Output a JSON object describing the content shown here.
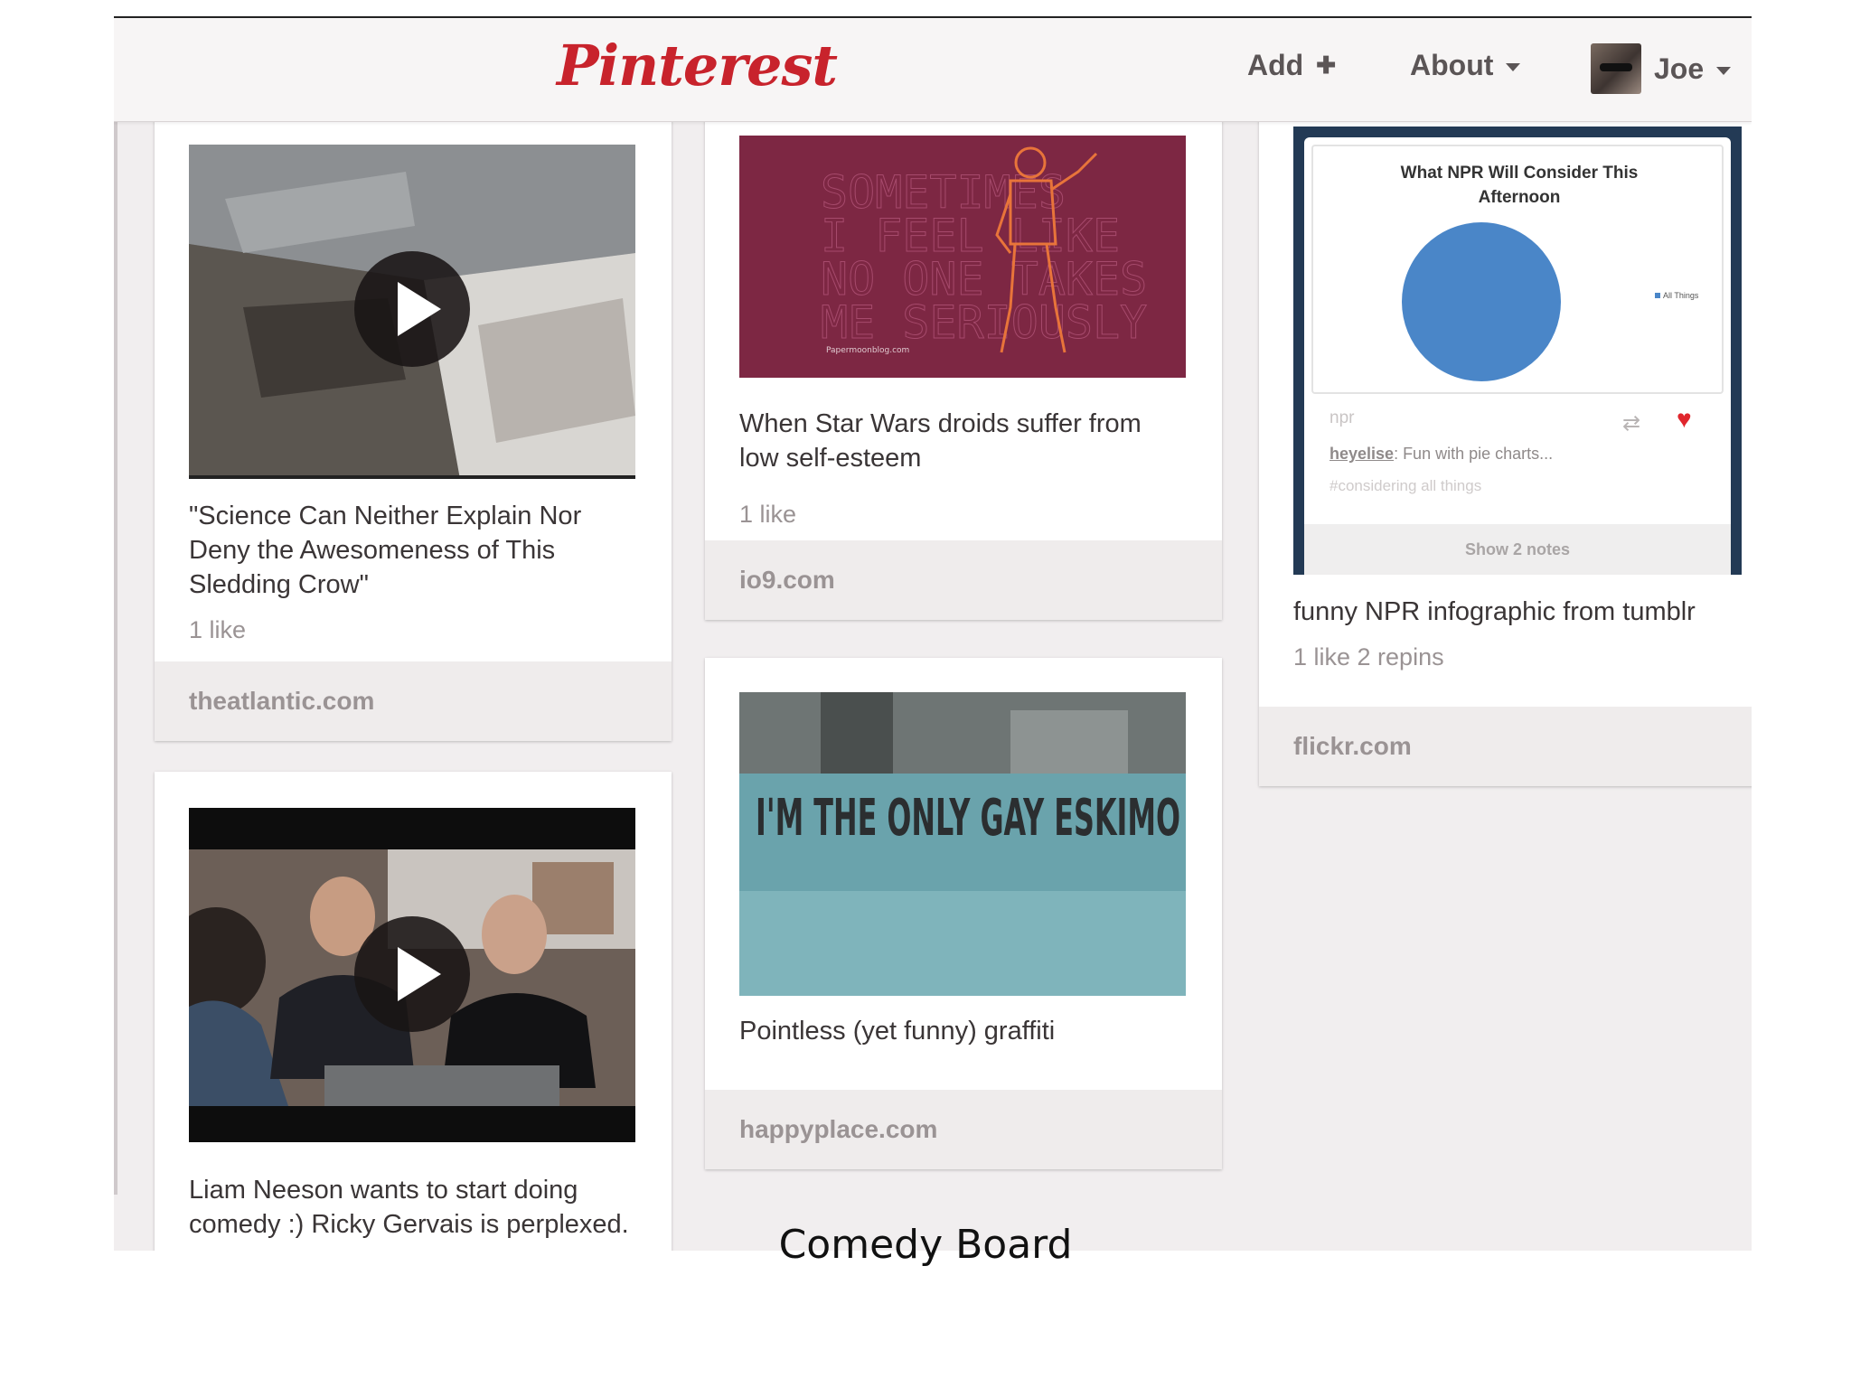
{
  "header": {
    "logo": "Pinterest",
    "add_label": "Add",
    "about_label": "About",
    "user_name": "Joe"
  },
  "pins": [
    {
      "description": "\"Science Can Neither Explain Nor Deny the Awesomeness of This Sledding Crow\"",
      "stats": "1 like",
      "source": "theatlantic.com"
    },
    {
      "description": "Liam Neeson wants to start doing comedy :) Ricky Gervais is perplexed.",
      "stats": "",
      "source": ""
    },
    {
      "description": "When Star Wars droids suffer from low self-esteem",
      "stats": "1 like",
      "source": "io9.com"
    },
    {
      "description": "Pointless (yet funny) graffiti",
      "stats": "",
      "source": "happyplace.com"
    },
    {
      "description": "funny NPR infographic from tumblr",
      "stats": "1 like  2 repins",
      "source": "flickr.com"
    }
  ],
  "poster": {
    "text": "SOMETIMES I FEEL LIKE NO ONE TAKES ME SERIOUSLY",
    "credit": "Papermoonblog.com"
  },
  "graffiti": {
    "text": "I'M THE ONLY GAY ESKIMO"
  },
  "npr": {
    "title": "What NPR Will Consider This Afternoon",
    "legend": "All Things",
    "source": "npr",
    "user": "heyelise",
    "post": ": Fun with pie charts...",
    "tag": "#considering all things",
    "notes": "Show 2 notes"
  },
  "slide_caption": "Comedy Board",
  "colors": {
    "brand": "#c8232c",
    "heart": "#e0262d",
    "pie": "#4a86c8"
  }
}
